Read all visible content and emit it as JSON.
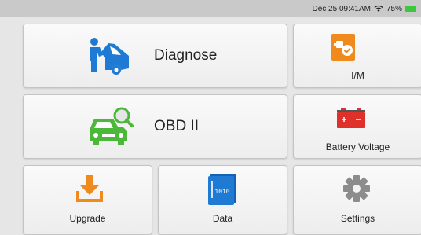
{
  "status": {
    "datetime": "Dec 25 09:41AM",
    "battery_pct": "75%",
    "battery_color": "#3cc83c"
  },
  "tiles": {
    "diagnose": {
      "label": "Diagnose",
      "icon": "mechanic-car-icon"
    },
    "im": {
      "label": "I/M",
      "icon": "inspection-check-icon"
    },
    "obd": {
      "label": "OBD II",
      "icon": "car-magnifier-icon"
    },
    "battery": {
      "label": "Battery Voltage",
      "icon": "car-battery-icon"
    },
    "upgrade": {
      "label": "Upgrade",
      "icon": "download-tray-icon"
    },
    "data": {
      "label": "Data",
      "icon": "binary-file-icon"
    },
    "settings": {
      "label": "Settings",
      "icon": "gear-icon"
    }
  },
  "colors": {
    "accent_blue": "#1e7ad2",
    "accent_green": "#4cb83a",
    "accent_orange": "#f08a1c",
    "accent_red": "#e0302a",
    "gear_gray": "#8c8c8c"
  }
}
